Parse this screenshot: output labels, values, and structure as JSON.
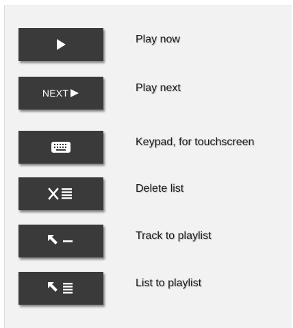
{
  "legend": {
    "items": [
      {
        "icon": "play-icon",
        "label": "Play now"
      },
      {
        "icon": "next-play-icon",
        "button_text": "NEXT",
        "label": "Play next"
      },
      {
        "icon": "keyboard-icon",
        "label": "Keypad, for touchscreen"
      },
      {
        "icon": "delete-list-icon",
        "label": "Delete list"
      },
      {
        "icon": "track-to-playlist-icon",
        "label": "Track to playlist"
      },
      {
        "icon": "list-to-playlist-icon",
        "label": "List to playlist"
      }
    ]
  },
  "colors": {
    "button_bg": "#3a3a3a",
    "panel_bg": "#f2f2f2",
    "icon": "#ffffff",
    "label_text": "#1a1a1a"
  }
}
